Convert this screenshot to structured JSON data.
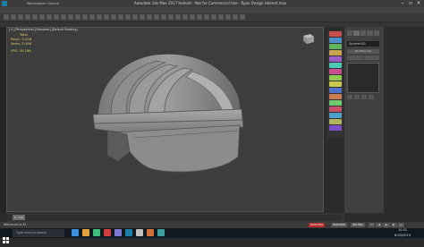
{
  "titlebar": {
    "title": "Autodesk 3ds Max 2017  Helmet - Not for Commercial Use - Ryan Design Helmet.max",
    "workspace": "Workspaces: Default"
  },
  "menubar": {
    "items": [
      "File",
      "Edit",
      "Tools",
      "Group",
      "Views",
      "Create",
      "Modifiers",
      "Animation",
      "Graph Editors",
      "Rendering",
      "Civil View",
      "Customize",
      "Scripting",
      "Help"
    ]
  },
  "ribbon": {
    "tabs": [
      "Object Paint",
      "Populate"
    ]
  },
  "viewport": {
    "label": "[+] [Perspective] [Standard] [Default Shading]",
    "stats_title": "Total",
    "polys_label": "Polys:",
    "polys_value": "3,436",
    "verts_label": "Verts:",
    "verts_value": "3,498",
    "fps_label": "FPS:",
    "fps_value": "35.186"
  },
  "command_panel": {
    "object_name": "Sphere001",
    "modifier_list": "Modifier List"
  },
  "timeline": {
    "slider_text": "0 / 100"
  },
  "statusbar": {
    "welcome": "Welcome to M",
    "autokey": "Auto Key",
    "setkey": "Set Key",
    "selected": "Selected"
  },
  "taskbar": {
    "search_placeholder": "Type here to search",
    "time": "10:51",
    "date": "6/30/2019"
  },
  "colors": {
    "accent_yellow": "#e0d060",
    "autokey_red": "#b52b2b",
    "taskbar_bg": "#101820"
  }
}
